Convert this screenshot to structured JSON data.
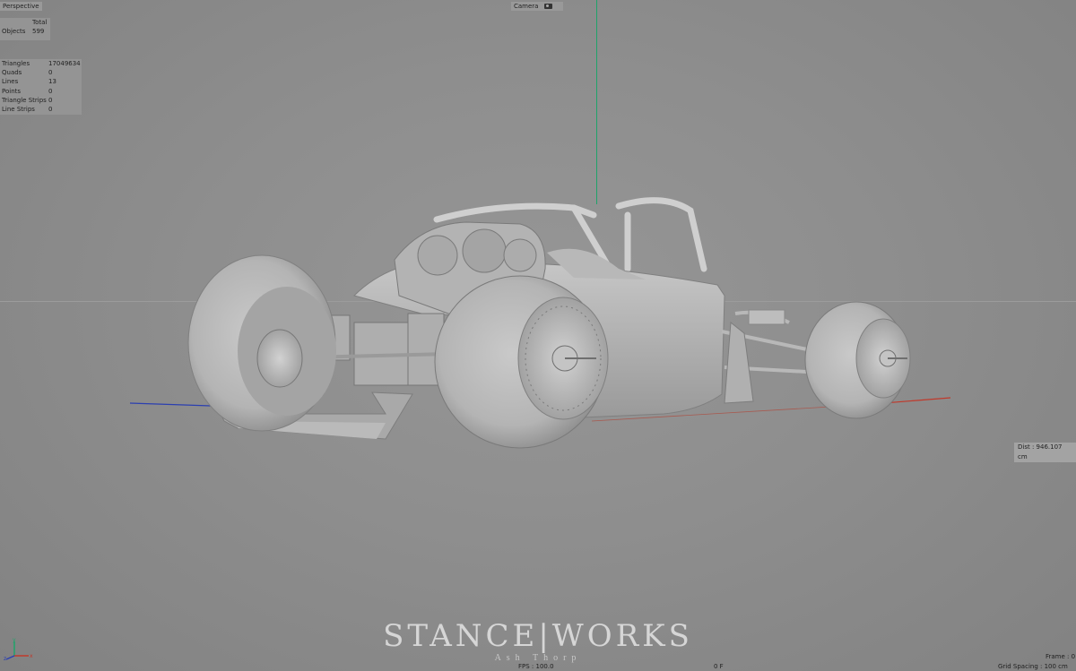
{
  "viewport": {
    "view_name": "Perspective",
    "camera_label": "Camera",
    "camera_icon": "camera-icon"
  },
  "object_stats": {
    "header": "Total",
    "objects_label": "Objects",
    "objects_value": "599"
  },
  "poly_stats": [
    {
      "label": "Triangles",
      "value": "17049634"
    },
    {
      "label": "Quads",
      "value": "0"
    },
    {
      "label": "Lines",
      "value": "13"
    },
    {
      "label": "Points",
      "value": "0"
    },
    {
      "label": "Triangle Strips",
      "value": "0"
    },
    {
      "label": "Line Strips",
      "value": "0"
    }
  ],
  "hud": {
    "distance": "Dist : 946.107 cm",
    "fps": "FPS : 100.0",
    "frame_counter": "0 F",
    "frame": "Frame : 0",
    "grid_spacing": "Grid Spacing : 100 cm"
  },
  "watermark": {
    "brand": "STANCE|WORKS",
    "author": "Ash Thorp"
  },
  "colors": {
    "y_axis": "#1fa36a",
    "x_axis": "#c0392b",
    "z_axis": "#2b3fb0",
    "background": "#8e8e8e"
  }
}
